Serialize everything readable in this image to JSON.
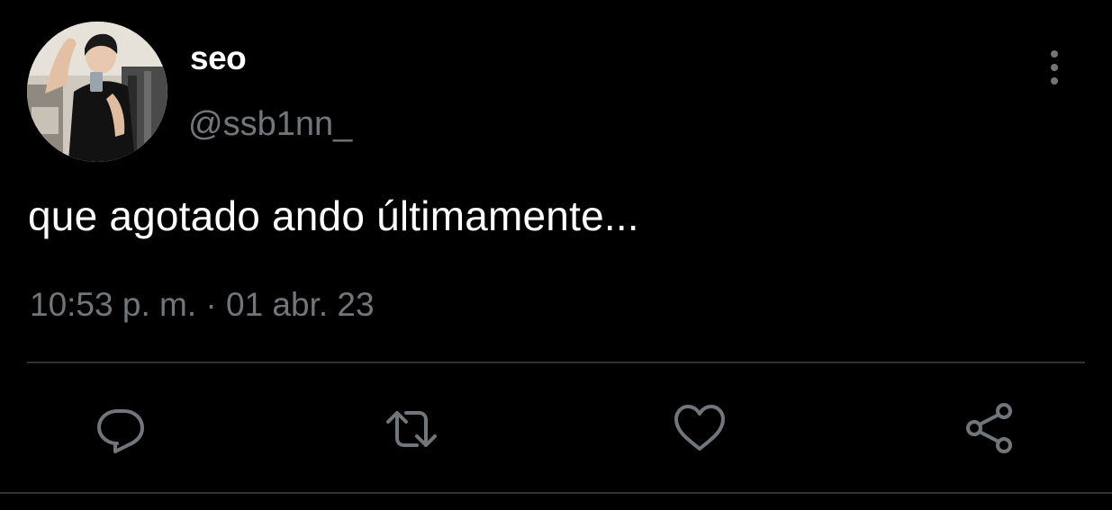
{
  "tweet": {
    "author": {
      "display_name": "seo",
      "handle": "@ssb1nn_"
    },
    "text": "que agotado ando últimamente...",
    "timestamp": "10:53 p. m. · 01 abr. 23"
  },
  "actions": [
    {
      "icon": "reply-icon"
    },
    {
      "icon": "retweet-icon"
    },
    {
      "icon": "like-icon"
    },
    {
      "icon": "share-icon"
    }
  ],
  "colors": {
    "background": "#000000",
    "primary_text": "#ffffff",
    "secondary_text": "#71767b",
    "divider": "#2f3336"
  }
}
